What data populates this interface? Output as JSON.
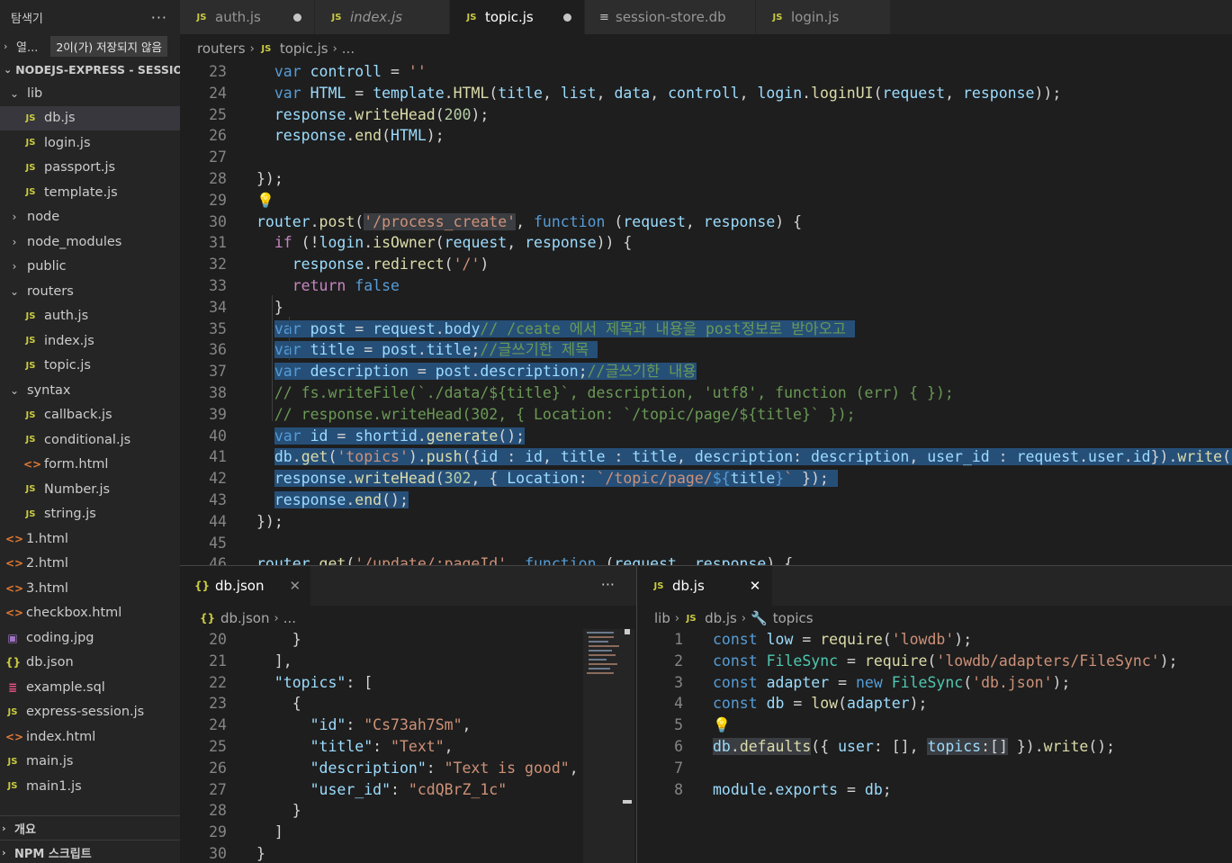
{
  "sidebar": {
    "title": "탐색기",
    "more": "···",
    "open_editors": {
      "label": "열...",
      "badge": "2이(가) 저장되지 않음"
    },
    "project": "NODEJS-EXPRESS - SESSIO...",
    "items": [
      {
        "label": "lib",
        "type": "folder-open"
      },
      {
        "label": "db.js",
        "type": "js",
        "selected": true
      },
      {
        "label": "login.js",
        "type": "js"
      },
      {
        "label": "passport.js",
        "type": "js"
      },
      {
        "label": "template.js",
        "type": "js"
      },
      {
        "label": "node",
        "type": "folder"
      },
      {
        "label": "node_modules",
        "type": "folder"
      },
      {
        "label": "public",
        "type": "folder"
      },
      {
        "label": "routers",
        "type": "folder-open"
      },
      {
        "label": "auth.js",
        "type": "js"
      },
      {
        "label": "index.js",
        "type": "js"
      },
      {
        "label": "topic.js",
        "type": "js"
      },
      {
        "label": "syntax",
        "type": "folder-open"
      },
      {
        "label": "callback.js",
        "type": "js"
      },
      {
        "label": "conditional.js",
        "type": "js"
      },
      {
        "label": "form.html",
        "type": "html"
      },
      {
        "label": "Number.js",
        "type": "js"
      },
      {
        "label": "string.js",
        "type": "js"
      },
      {
        "label": "1.html",
        "type": "html"
      },
      {
        "label": "2.html",
        "type": "html"
      },
      {
        "label": "3.html",
        "type": "html"
      },
      {
        "label": "checkbox.html",
        "type": "html"
      },
      {
        "label": "coding.jpg",
        "type": "img"
      },
      {
        "label": "db.json",
        "type": "json"
      },
      {
        "label": "example.sql",
        "type": "sql"
      },
      {
        "label": "express-session.js",
        "type": "js"
      },
      {
        "label": "index.html",
        "type": "html"
      },
      {
        "label": "main.js",
        "type": "js"
      },
      {
        "label": "main1.js",
        "type": "js"
      }
    ],
    "outline": "개요",
    "npm": "NPM 스크립트"
  },
  "tabs": [
    {
      "label": "auth.js",
      "icon": "JS",
      "dirty": true,
      "active": false,
      "italic": false
    },
    {
      "label": "index.js",
      "icon": "JS",
      "dirty": false,
      "active": false,
      "italic": true
    },
    {
      "label": "topic.js",
      "icon": "JS",
      "dirty": true,
      "active": true,
      "italic": false
    },
    {
      "label": "session-store.db",
      "icon": "≡",
      "dirty": false,
      "active": false,
      "italic": false
    },
    {
      "label": "login.js",
      "icon": "JS",
      "dirty": false,
      "active": false,
      "italic": false
    }
  ],
  "top_editor": {
    "breadcrumb": [
      "routers",
      "topic.js",
      "..."
    ],
    "lines": [
      {
        "n": "23",
        "html": "  <span class='kw'>var</span> <span class='var'>controll</span> = <span class='str'>''</span>"
      },
      {
        "n": "24",
        "html": "  <span class='kw'>var</span> <span class='var'>HTML</span> = <span class='var'>template</span>.<span class='fn'>HTML</span>(<span class='var'>title</span>, <span class='var'>list</span>, <span class='var'>data</span>, <span class='var'>controll</span>, <span class='var'>login</span>.<span class='fn'>loginUI</span>(<span class='var'>request</span>, <span class='var'>response</span>));"
      },
      {
        "n": "25",
        "html": "  <span class='var'>response</span>.<span class='fn'>writeHead</span>(<span class='num'>200</span>);"
      },
      {
        "n": "26",
        "html": "  <span class='var'>response</span>.<span class='fn'>end</span>(<span class='var'>HTML</span>);"
      },
      {
        "n": "27",
        "html": ""
      },
      {
        "n": "28",
        "html": "});"
      },
      {
        "n": "29",
        "html": "<span class='bulb'>💡</span>"
      },
      {
        "n": "30",
        "html": "<span class='var'>router</span>.<span class='fn'>post</span>(<span class='str' style='background:#3a3d41'>'/process_create'</span>, <span class='kw'>function</span> (<span class='var'>request</span>, <span class='var'>response</span>) {"
      },
      {
        "n": "31",
        "html": "  <span class='kw2'>if</span> (!<span class='var'>login</span>.<span class='fn'>isOwner</span>(<span class='var'>request</span>, <span class='var'>response</span>)) {"
      },
      {
        "n": "32",
        "html": "    <span class='var'>response</span>.<span class='fn'>redirect</span>(<span class='str'>'/'</span>)"
      },
      {
        "n": "33",
        "html": "    <span class='kw2'>return</span> <span class='kw'>false</span>"
      },
      {
        "n": "34",
        "html": "  }"
      },
      {
        "n": "35",
        "html": "  <span class='sel'><span class='kw'>var</span> <span class='var'>post</span> = <span class='var'>request</span>.<span class='var'>body</span><span class='cmt'>// /ceate 에서 제목과 내용을 post정보로 받아오고 </span></span>"
      },
      {
        "n": "36",
        "html": "  <span class='sel'><span class='kw'>var</span> <span class='var'>title</span> = <span class='var'>post</span>.<span class='var'>title</span>;<span class='cmt'>//글쓰기한 제목 </span></span>"
      },
      {
        "n": "37",
        "html": "  <span class='sel'><span class='kw'>var</span> <span class='var'>description</span> = <span class='var'>post</span>.<span class='var'>description</span>;<span class='cmt'>//글쓰기한 내용</span></span>"
      },
      {
        "n": "38",
        "html": "  <span class='cmt'>// fs.writeFile(`./data/${title}`, description, 'utf8', function (err) { });</span>"
      },
      {
        "n": "39",
        "html": "  <span class='cmt'>// response.writeHead(302, { Location: `/topic/page/${title}` });</span>"
      },
      {
        "n": "40",
        "html": "  <span class='sel'><span class='kw'>var</span> <span class='var'>id</span> = <span class='var'>shortid</span>.<span class='fn'>generate</span>();</span>"
      },
      {
        "n": "41",
        "html": "  <span class='sel'><span class='var'>db</span>.<span class='fn'>get</span>(<span class='str'>'topics'</span>).<span class='fn'>push</span>({<span class='var'>id</span> : <span class='var'>id</span>, <span class='var'>title</span> : <span class='var'>title</span>, <span class='var'>description</span>: <span class='var'>description</span>, <span class='var'>user_id</span> : <span class='var'>request</span>.<span class='var'>user</span>.<span class='var'>id</span>}).<span class='fn'>write</span>();</span>"
      },
      {
        "n": "42",
        "html": "  <span class='sel'><span class='var'>response</span>.<span class='fn'>writeHead</span>(<span class='num'>302</span>, { <span class='var'>Location</span>: <span class='str'>`/topic/page/</span><span class='kw'>${</span><span class='var'>title</span><span class='kw'>}</span><span class='str'>`</span> }); </span>"
      },
      {
        "n": "43",
        "html": "  <span class='sel'><span class='var'>response</span>.<span class='fn'>end</span>();</span>"
      },
      {
        "n": "44",
        "html": "});"
      },
      {
        "n": "45",
        "html": ""
      },
      {
        "n": "46",
        "html": "<span class='var'>router</span>.<span class='fn'>get</span>(<span class='str'>'/update/:pageId'</span>, <span class='kw'>function</span> (<span class='var'>request</span>, <span class='var'>response</span>) {"
      }
    ]
  },
  "left_pane": {
    "tab_label": "db.json",
    "tab_icon": "{}",
    "close": "✕",
    "more": "···",
    "breadcrumb": [
      "db.json",
      "..."
    ],
    "lines": [
      {
        "n": "20",
        "html": "    }"
      },
      {
        "n": "21",
        "html": "  ],"
      },
      {
        "n": "22",
        "html": "  <span class='var'>\"topics\"</span>: ["
      },
      {
        "n": "23",
        "html": "    {"
      },
      {
        "n": "24",
        "html": "      <span class='var'>\"id\"</span>: <span class='str'>\"Cs73ah7Sm\"</span>,"
      },
      {
        "n": "25",
        "html": "      <span class='var'>\"title\"</span>: <span class='str'>\"Text\"</span>,"
      },
      {
        "n": "26",
        "html": "      <span class='var'>\"description\"</span>: <span class='str'>\"Text is good\"</span>,"
      },
      {
        "n": "27",
        "html": "      <span class='var'>\"user_id\"</span>: <span class='str'>\"cdQBrZ_1c\"</span>"
      },
      {
        "n": "28",
        "html": "    }"
      },
      {
        "n": "29",
        "html": "  ]"
      },
      {
        "n": "30",
        "html": "}"
      }
    ]
  },
  "right_pane": {
    "tab_label": "db.js",
    "tab_icon": "JS",
    "close": "✕",
    "breadcrumb": [
      "lib",
      "db.js",
      "topics"
    ],
    "lines": [
      {
        "n": "1",
        "html": "<span class='kw'>const</span> <span class='var'>low</span> = <span class='fn'>require</span>(<span class='str'>'lowdb'</span>);"
      },
      {
        "n": "2",
        "html": "<span class='kw'>const</span> <span class='cls'>FileSync</span> = <span class='fn'>require</span>(<span class='str'>'lowdb/adapters/FileSync'</span>);"
      },
      {
        "n": "3",
        "html": "<span class='kw'>const</span> <span class='var'>adapter</span> = <span class='kw'>new</span> <span class='cls'>FileSync</span>(<span class='str'>'db.json'</span>);"
      },
      {
        "n": "4",
        "html": "<span class='kw'>const</span> <span class='var'>db</span> = <span class='fn'>low</span>(<span class='var'>adapter</span>);"
      },
      {
        "n": "5",
        "html": "<span class='bulb'>💡</span>"
      },
      {
        "n": "6",
        "html": "<span style='background:#3a3d41'><span class='var'>db</span>.<span class='fn'>defaults</span></span>({ <span class='var'>user</span>: [], <span style='background:#3a3d41'><span class='var'>topics</span>:[]</span> }).<span class='fn'>write</span>();"
      },
      {
        "n": "7",
        "html": ""
      },
      {
        "n": "8",
        "html": "<span class='var'>module</span>.<span class='var'>exports</span> = <span class='var'>db</span>;"
      }
    ]
  }
}
